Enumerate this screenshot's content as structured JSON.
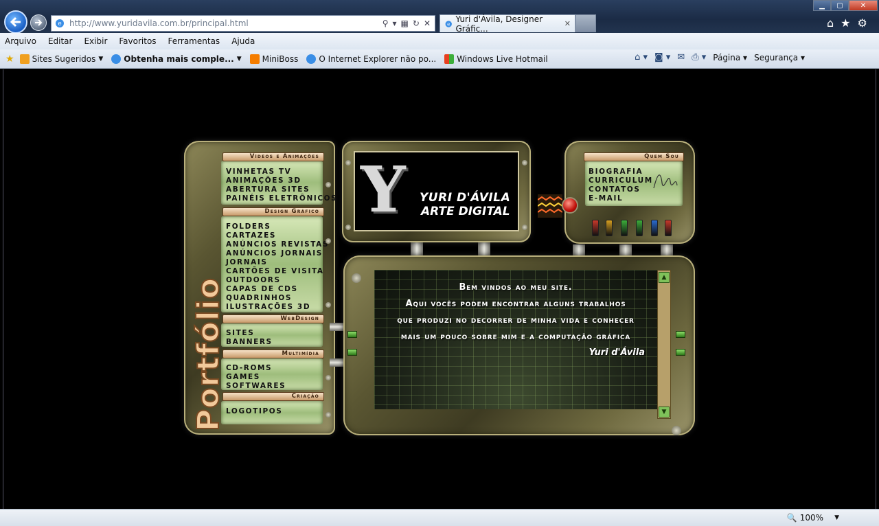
{
  "browser": {
    "url": "http://www.yuridavila.com.br/principal.html",
    "tab_title": "Yuri d'Ávila, Designer Gráfic...",
    "menu": [
      "Arquivo",
      "Editar",
      "Exibir",
      "Favoritos",
      "Ferramentas",
      "Ajuda"
    ],
    "favorites": [
      "Sites Sugeridos",
      "Obtenha mais comple...",
      "MiniBoss",
      "O Internet Explorer não po...",
      "Windows Live Hotmail"
    ],
    "commands": [
      "Página",
      "Segurança"
    ],
    "zoom": "100%"
  },
  "site": {
    "side_title": "Portfólio",
    "logo": {
      "letter": "Y",
      "name": "YURI D'ÁVILA",
      "subtitle": "ARTE DIGITAL"
    },
    "sections": {
      "videos": {
        "header": "Vídeos e Animações",
        "items": [
          "Vinhetas TV",
          "Animações 3D",
          "Abertura Sites",
          "Painéis Eletrônicos"
        ]
      },
      "design": {
        "header": "Design Gráfico",
        "items": [
          "Folders",
          "Cartazes",
          "Anúncios Revistas",
          "Anúncios Jornais",
          "Jornais",
          "Cartões de Visita",
          "Outdoors",
          "Capas de Cds",
          "Quadrinhos",
          "Ilustrações 3D"
        ]
      },
      "web": {
        "header": "WebDesign",
        "items": [
          "Sites",
          "Banners"
        ]
      },
      "multimedia": {
        "header": "Multimídia",
        "items": [
          "CD-Roms",
          "Games",
          "Softwares"
        ]
      },
      "creation": {
        "header": "Criação",
        "items": [
          "Logotipos"
        ]
      },
      "about": {
        "header": "Quem Sou",
        "items": [
          "Biografia",
          "Curriculum",
          "Contatos",
          "E-mail"
        ]
      }
    },
    "welcome": {
      "lines": [
        "Bem vindos ao meu site.",
        "Aqui vocês podem encontrar alguns trabalhos",
        "que produzi no decorrer de minha vida e conhecer",
        "mais um pouco sobre mim e a computação gráfica"
      ],
      "signature": "Yuri d'Ávila"
    },
    "led_colors": [
      "#c8382a",
      "#d8a020",
      "#3cae3a",
      "#3cae3a",
      "#2a6ad0",
      "#c8382a"
    ]
  }
}
